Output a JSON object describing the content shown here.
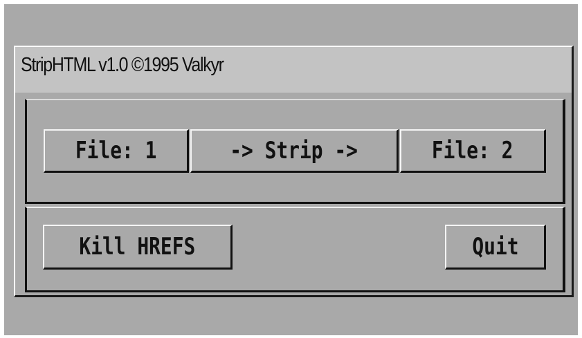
{
  "window": {
    "title": "StripHTML v1.0 ©1995 Valkyr"
  },
  "buttons": {
    "file1_label": "File: 1",
    "strip_label": "-> Strip ->",
    "file2_label": "File: 2",
    "kill_hrefs_label": "Kill HREFS",
    "quit_label": "Quit"
  },
  "colors": {
    "background": "#a9a9a9",
    "titlebar": "#c3c3c3",
    "shadow": "#111111",
    "highlight": "#f5f5f5"
  }
}
